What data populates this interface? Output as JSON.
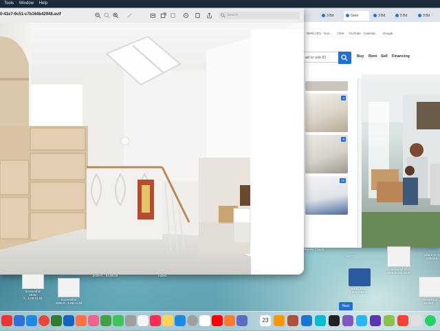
{
  "menubar": {
    "items": [
      "Tools",
      "Window",
      "Help"
    ]
  },
  "preview": {
    "file_title": "0-41e7-9c51-c7b164b42948.avif",
    "search_placeholder": "Search"
  },
  "browser": {
    "tabs": [
      {
        "label": "3 Bd"
      },
      {
        "label": "Gree"
      },
      {
        "label": "3 Bd"
      },
      {
        "label": "5 Bd"
      },
      {
        "label": "3 Bd"
      }
    ],
    "bookmarks": [
      "Wells (3D) - Goo...",
      "Chat",
      "YouTube - Calenda...",
      "Google"
    ],
    "search_placeholder": "ad or unit ID",
    "nav": [
      "Buy",
      "Rent",
      "Sell",
      "Financing"
    ],
    "listing_badges": [
      "4",
      "6",
      "10"
    ],
    "next_label": "Next",
    "partial_text": "Gr"
  },
  "desktop": {
    "files": [
      {
        "label": "Screenshot\n2026-0...1.09.11.16"
      },
      {
        "label": "Screenshot\n2026-0...1.09.11.22"
      },
      {
        "label": "2026-0... 04.00.03"
      },
      {
        "label": "Indesi..."
      },
      {
        "label": "Pomon Condo"
      },
      {
        "label": "WITT"
      },
      {
        "label": "Screenshot\n2026-0...09.43.00"
      },
      {
        "label": "villa 174, A...\nresident..."
      },
      {
        "label": "WELL BEC -\npromotions"
      },
      {
        "label": "Screenshot\n2026-0..."
      }
    ]
  },
  "dock": {
    "calendar_day": "23"
  },
  "colors": {
    "accent": "#1f6fd6",
    "menubar": "#1d2b3a"
  }
}
